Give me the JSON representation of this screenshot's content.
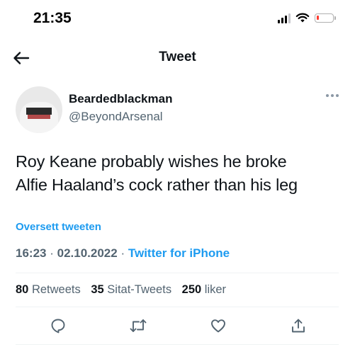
{
  "status_bar": {
    "time": "21:35",
    "battery_color": "#ff3b30"
  },
  "header": {
    "title": "Tweet",
    "back_icon": "arrow-left-icon"
  },
  "tweet": {
    "author": {
      "display_name": "Beardedblackman",
      "handle": "@BeyondArsenal"
    },
    "text_lines": [
      "Roy Keane probably wishes he broke",
      "Alfie Haaland’s cock rather than his leg"
    ],
    "translate_label": "Oversett tweeten",
    "time": "16:23",
    "date": "02.10.2022",
    "separator": "·",
    "source": "Twitter for iPhone",
    "stats": {
      "retweets_count": "80",
      "retweets_label": "Retweets",
      "quotes_count": "35",
      "quotes_label": "Sitat-Tweets",
      "likes_count": "250",
      "likes_label": "liker"
    }
  },
  "colors": {
    "accent": "#1d9bf0",
    "secondary_text": "#536471",
    "primary_text": "#0f1419"
  },
  "actions": [
    "reply-icon",
    "retweet-icon",
    "like-icon",
    "share-icon"
  ]
}
